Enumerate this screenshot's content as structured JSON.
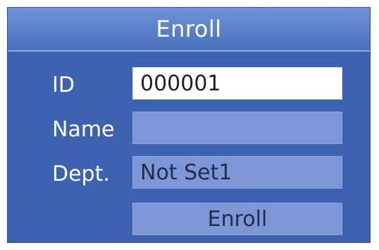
{
  "screen": {
    "title": "Enroll"
  },
  "form": {
    "id": {
      "label": "ID",
      "value": "000001"
    },
    "name": {
      "label": "Name",
      "value": ""
    },
    "dept": {
      "label": "Dept.",
      "value": "Not Set1"
    }
  },
  "actions": {
    "enroll_label": "Enroll"
  },
  "colors": {
    "background": "#3d62b2",
    "title_bar": "#5b80c9",
    "field_inactive": "#7d96d6",
    "field_active": "#ffffff"
  }
}
